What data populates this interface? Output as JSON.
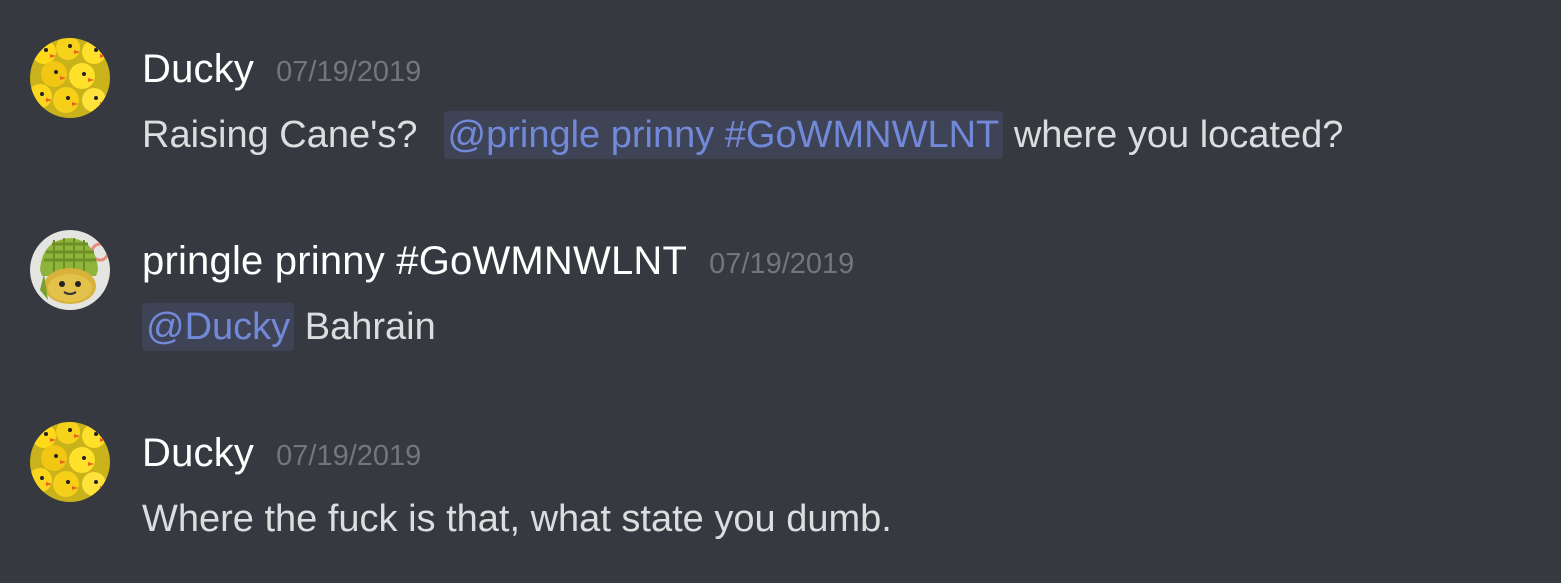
{
  "colors": {
    "background": "#36393f",
    "username": "#ffffff",
    "timestamp": "#72767d",
    "text": "#dcddde",
    "mention_text": "#7289da",
    "mention_bg": "#3e4558"
  },
  "messages": [
    {
      "avatar_icon": "duck-pile-avatar-icon",
      "username": "Ducky",
      "timestamp": "07/19/2019",
      "text_before": "Raising Cane's?",
      "mention": "@pringle prinny #GoWMNWLNT",
      "text_after": "where you located?"
    },
    {
      "avatar_icon": "green-helmet-avatar-icon",
      "username": "pringle prinny #GoWMNWLNT",
      "timestamp": "07/19/2019",
      "mention": "@Ducky",
      "text_after": "Bahrain"
    },
    {
      "avatar_icon": "duck-pile-avatar-icon",
      "username": "Ducky",
      "timestamp": "07/19/2019",
      "text": "Where the fuck is that, what state you dumb."
    }
  ]
}
